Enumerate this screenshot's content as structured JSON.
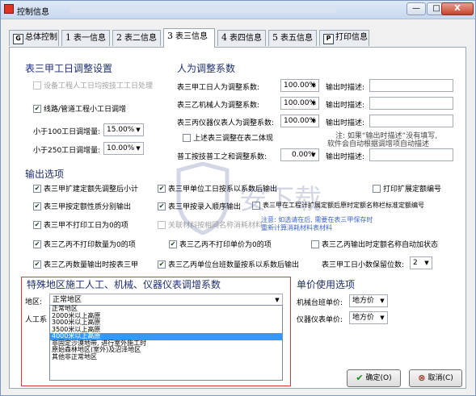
{
  "window": {
    "title": "控制信息",
    "minimize_label": "—",
    "maximize_label": "□",
    "close_label": "X"
  },
  "tabs": [
    {
      "num": "",
      "icon": "G",
      "label": "总体控制"
    },
    {
      "num": "1",
      "label": "表一信息"
    },
    {
      "num": "2",
      "label": "表二信息"
    },
    {
      "num": "3",
      "label": "表三信息"
    },
    {
      "num": "4",
      "label": "表四信息"
    },
    {
      "num": "5",
      "label": "表五信息"
    },
    {
      "num": "",
      "icon": "P",
      "label": "打印信息"
    }
  ],
  "left": {
    "title": "表三甲工日调整设置",
    "cb1": "设备工程人工日均按技工工日处理",
    "cb2": "线路/管道工程小工日调增",
    "row1_label": "小于100工日调增量:",
    "row1_value": "15.00%",
    "row2_label": "小于250工日调增量:",
    "row2_value": "10.00%"
  },
  "right": {
    "title": "人为调整系数",
    "rows": [
      {
        "label": "表三甲工日人为调整系数:",
        "value": "100.00%",
        "desc": "输出时描述:"
      },
      {
        "label": "表三乙机械人为调整系数:",
        "value": "100.00%",
        "desc": "输出时描述:"
      },
      {
        "label": "表三丙仪器仪表人为调整系数:",
        "value": "100.00%",
        "desc": "输出时描述:"
      }
    ],
    "cb_show": "上述表三调整在表二体现",
    "note1": "注: 如果“输出时描述”没有填写,",
    "note2": "软件会自动根据调增项自动描述",
    "row4_label": "普工按技普工之和调整系数:",
    "row4_value": "0.00%",
    "row4_desc": "输出时描述:"
  },
  "output": {
    "title": "输出选项",
    "cb": [
      "表三甲扩建定额先调整后小计",
      "表三甲单位工日按系以系数后输出",
      "打印扩展定额编号",
      "表三甲按定额性质分别输出",
      "表三甲按录入顺序输出",
      "表三甲在工程计扩展定额后原时定额名称栏标准定额编号",
      "表三甲不打印工日为0的项",
      "关联材料按相同名称消耗材料",
      "表三乙丙不打印数量为0的项",
      "表三乙丙不打印单价为0的项",
      "表三乙丙输出时定额名称自动加状态",
      "表三乙丙数量输出时按表三甲",
      "表三乙丙单位台班数量按系以系数后输出"
    ],
    "hint": "注意: 如选请在后, 需要在表三甲保存时",
    "hint2": "重新计算消耗材料表材料",
    "digits_label": "表三甲工日小数保留位数:",
    "digits_value": "2"
  },
  "region": {
    "title": "特殊地区施工人工、机械、仪器仪表调增系数",
    "area_label": "地区:",
    "area_value": "正常地区",
    "labor_label": "人工系",
    "options": [
      "正常地区",
      "2000米以上高原",
      "3000米以上高原",
      "3500米以上高原",
      "4000米以上高原",
      "非固定沙漠地带, 进行室外施工时",
      "原始森林地区(室外)及沼泽地区",
      "其他非正常地区"
    ],
    "highlighted": 4
  },
  "unit_price": {
    "title": "单价使用选项",
    "machine_label": "机械台班单价:",
    "machine_value": "地方价",
    "instrument_label": "仪器仪表单价:",
    "instrument_value": "地方价"
  },
  "buttons": {
    "ok": "确定(O)",
    "cancel": "取消(C)"
  },
  "watermark": "安下载"
}
